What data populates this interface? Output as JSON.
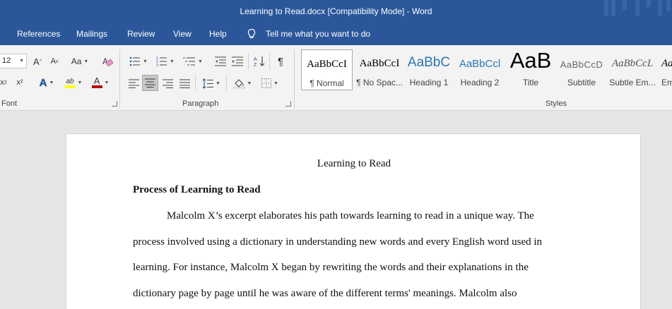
{
  "window": {
    "title": "Learning to Read.docx [Compatibility Mode]  -  Word"
  },
  "tabs": [
    {
      "label": "References"
    },
    {
      "label": "Mailings"
    },
    {
      "label": "Review"
    },
    {
      "label": "View"
    },
    {
      "label": "Help"
    }
  ],
  "tell_me": {
    "label": "Tell me what you want to do"
  },
  "ribbon": {
    "font": {
      "size_value": "12",
      "group_label": "Font",
      "grow_label": "A",
      "shrink_label": "A",
      "case_label": "Aa",
      "subscript_label": "x",
      "superscript_label": "x²",
      "text_effects_label": "A",
      "highlight_label": "ab",
      "font_color_label": "A",
      "highlight_color": "#ffff00",
      "font_color": "#c00000"
    },
    "paragraph": {
      "group_label": "Paragraph",
      "pilcrow": "¶"
    },
    "styles": {
      "group_label": "Styles",
      "items": [
        {
          "sample": "AaBbCcI",
          "name": "¶ Normal"
        },
        {
          "sample": "AaBbCcI",
          "name": "¶ No Spac..."
        },
        {
          "sample": "AaBbC",
          "name": "Heading 1"
        },
        {
          "sample": "AaBbCcl",
          "name": "Heading 2"
        },
        {
          "sample": "AaB",
          "name": "Title"
        },
        {
          "sample": "AaBbCcD",
          "name": "Subtitle"
        },
        {
          "sample": "AaBbCcL",
          "name": "Subtle Em..."
        },
        {
          "sample": "Aa",
          "name": "Em"
        }
      ]
    }
  },
  "document": {
    "title": "Learning to Read",
    "heading": "Process of Learning to Read",
    "lines": [
      "Malcolm X’s excerpt elaborates his path towards learning to read in a unique way. The",
      "process involved using a dictionary in understanding new words and every English word used in",
      "learning. For instance, Malcolm X began by rewriting the words and their explanations in the",
      "dictionary page by page until he was aware of the different terms' meanings. Malcolm also"
    ]
  },
  "colors": {
    "brand": "#2b579a",
    "ribbon_bg": "#f3f3f3",
    "canvas_bg": "#e6e6e6",
    "heading_blue": "#2e74b5"
  }
}
